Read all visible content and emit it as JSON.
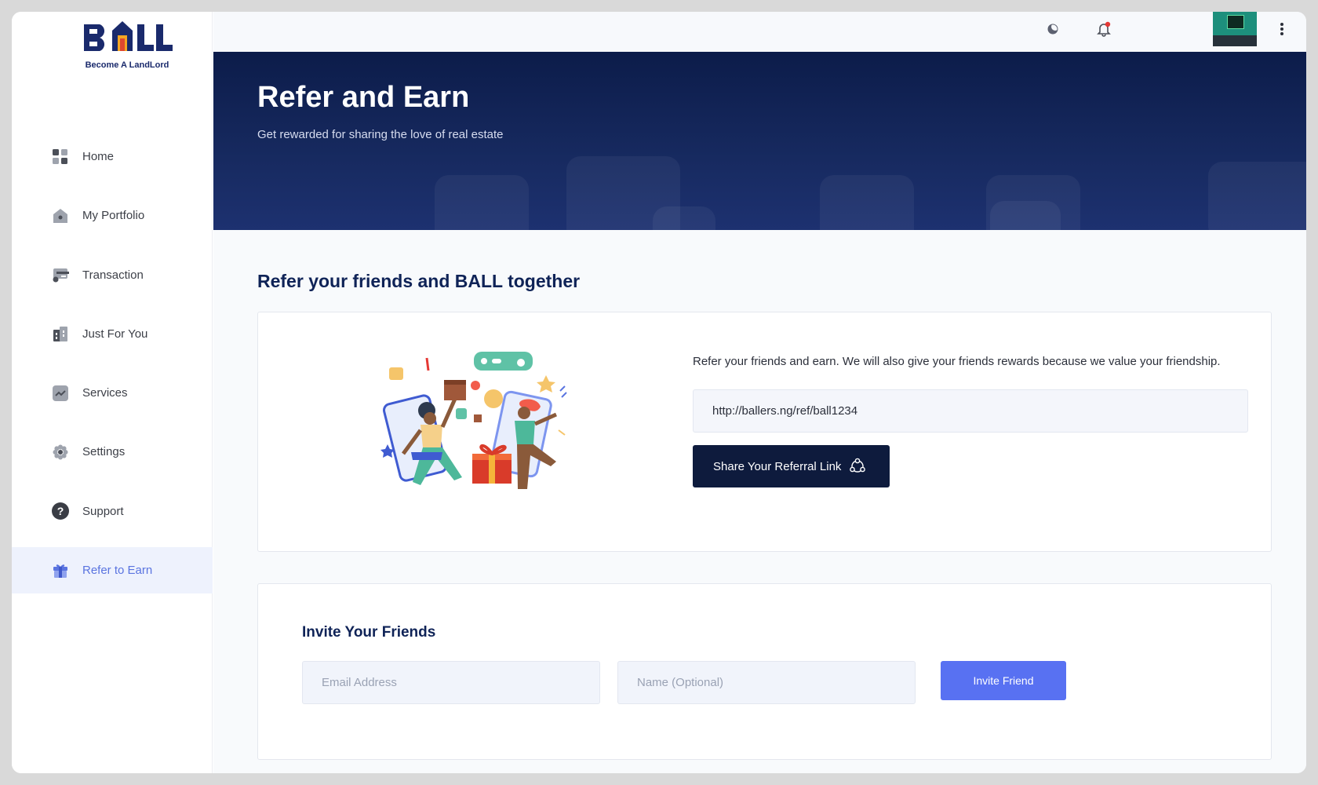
{
  "brand": {
    "logo_text": "BALL",
    "tagline": "Become A LandLord"
  },
  "sidebar": {
    "items": [
      {
        "label": "Home",
        "icon": "grid-icon"
      },
      {
        "label": "My Portfolio",
        "icon": "house-icon"
      },
      {
        "label": "Transaction",
        "icon": "wallet-icon"
      },
      {
        "label": "Just For You",
        "icon": "building-icon"
      },
      {
        "label": "Services",
        "icon": "chart-icon"
      },
      {
        "label": "Settings",
        "icon": "gear-icon"
      },
      {
        "label": "Support",
        "icon": "question-icon"
      },
      {
        "label": "Refer to Earn",
        "icon": "gift-icon",
        "active": true
      }
    ]
  },
  "topbar": {
    "icons": [
      "moon-icon",
      "bell-icon",
      "avatar",
      "more-vertical-icon"
    ],
    "notification_dot_color": "#e53935"
  },
  "banner": {
    "title": "Refer and Earn",
    "subtitle": "Get rewarded for sharing the love of real estate"
  },
  "refer_section": {
    "title": "Refer your friends and BALL together",
    "description": "Refer your friends and earn. We will also give your friends rewards because we value your friendship.",
    "referral_link": "http://ballers.ng/ref/ball1234",
    "share_button_label": "Share Your Referral Link"
  },
  "invite_section": {
    "title": "Invite Your Friends",
    "email_placeholder": "Email Address",
    "name_placeholder": "Name (Optional)",
    "invite_button_label": "Invite Friend"
  },
  "colors": {
    "navy": "#0f2357",
    "accent": "#5871f2",
    "active_nav": "#5a74e0",
    "share_button": "#0e1b3d"
  }
}
